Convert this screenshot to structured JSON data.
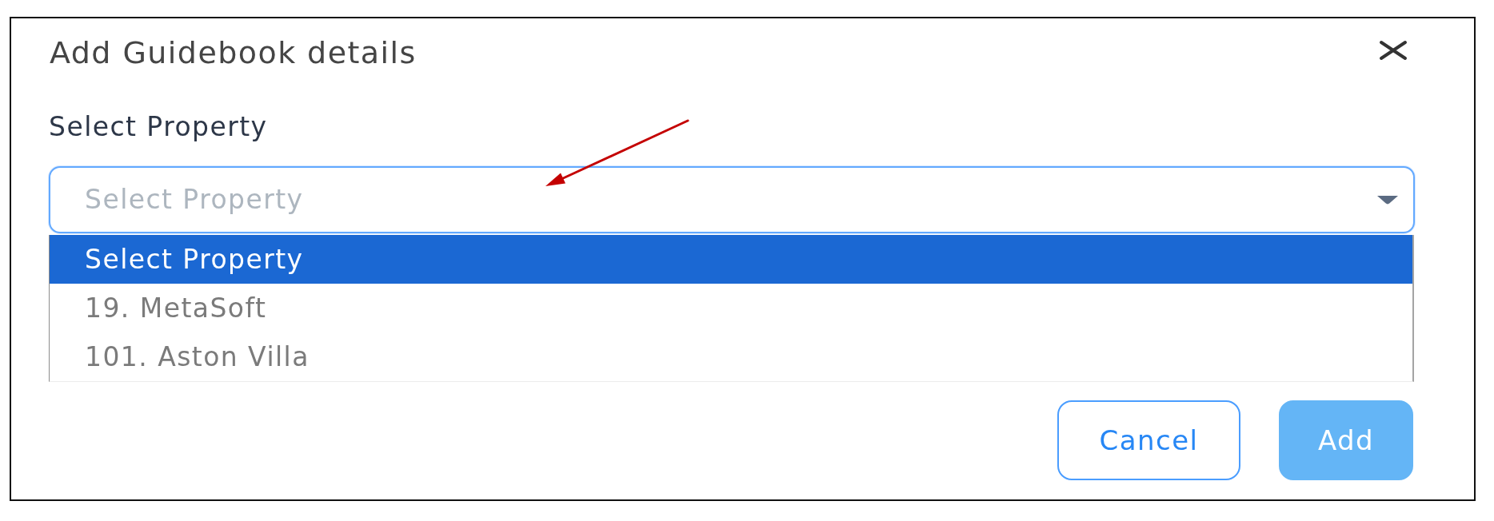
{
  "dialog": {
    "title": "Add Guidebook details"
  },
  "property_field": {
    "label": "Select Property",
    "placeholder": "Select Property",
    "expanded": true,
    "options": [
      {
        "label": "Select Property",
        "selected": true
      },
      {
        "label": "19. MetaSoft",
        "selected": false
      },
      {
        "label": "101. Aston Villa",
        "selected": false
      }
    ]
  },
  "buttons": [
    {
      "label": "Cancel",
      "kind": "outline",
      "disabled": false
    },
    {
      "label": "Add",
      "kind": "filled",
      "disabled": true
    }
  ]
}
